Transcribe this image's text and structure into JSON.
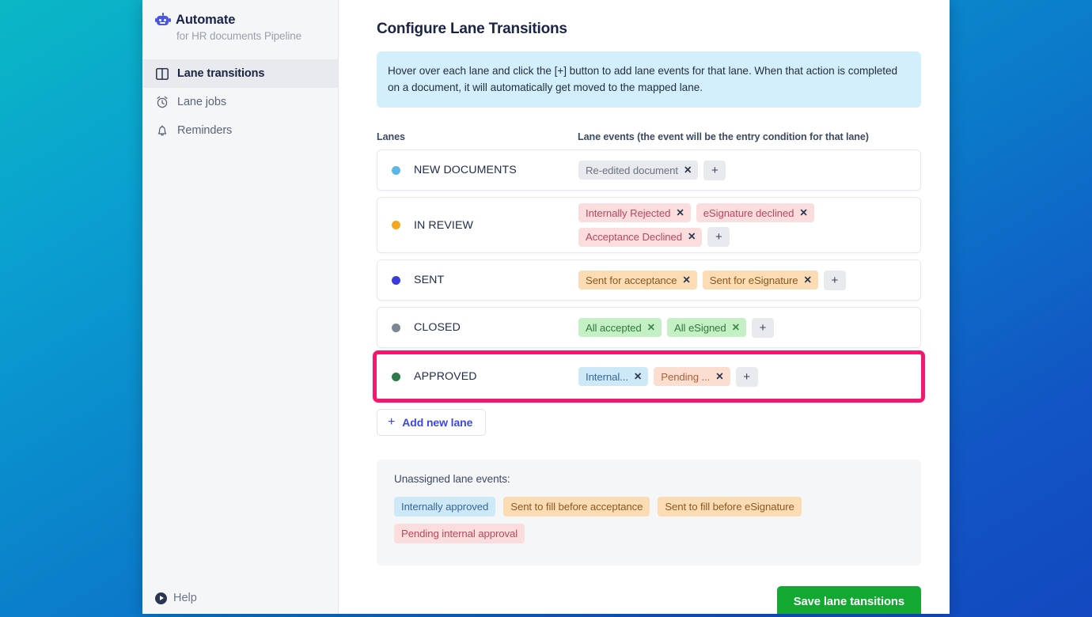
{
  "app": {
    "brand_name": "Automate",
    "brand_subtitle": "for HR documents Pipeline",
    "robot_icon": "robot-icon"
  },
  "sidebar": {
    "items": [
      {
        "label": "Lane transitions",
        "icon": "columns-icon",
        "active": true
      },
      {
        "label": "Lane jobs",
        "icon": "alarm-clock-icon",
        "active": false
      },
      {
        "label": "Reminders",
        "icon": "bell-icon",
        "active": false
      }
    ],
    "help_label": "Help",
    "help_icon": "play-circle-icon"
  },
  "main": {
    "title": "Configure Lane Transitions",
    "info_banner": "Hover over each lane and click the [+] button to add lane events for that lane. When that action is completed on a document, it will automatically get moved to the mapped lane.",
    "column_headers": {
      "lanes": "Lanes",
      "events": "Lane events (the event will be the entry condition for that lane)"
    },
    "add_button": {
      "plus": "+",
      "label": "Add new lane"
    },
    "plus_label": "+",
    "remove_label": "✕",
    "lanes": [
      {
        "name": "NEW DOCUMENTS",
        "dot_color": "#5bb7e8",
        "highlighted": false,
        "events": [
          {
            "label": "Re-edited document",
            "style": "gray"
          }
        ]
      },
      {
        "name": "IN REVIEW",
        "dot_color": "#f5a623",
        "highlighted": false,
        "events": [
          {
            "label": "Internally Rejected",
            "style": "rose"
          },
          {
            "label": "eSignature declined",
            "style": "rose"
          },
          {
            "label": "Acceptance Declined",
            "style": "rose"
          }
        ]
      },
      {
        "name": "SENT",
        "dot_color": "#3b3bdb",
        "highlighted": false,
        "events": [
          {
            "label": "Sent for acceptance",
            "style": "orange"
          },
          {
            "label": "Sent for eSignature",
            "style": "orange"
          }
        ]
      },
      {
        "name": "CLOSED",
        "dot_color": "#7d8694",
        "highlighted": false,
        "events": [
          {
            "label": "All accepted",
            "style": "green"
          },
          {
            "label": "All eSigned",
            "style": "green"
          }
        ]
      },
      {
        "name": "APPROVED",
        "dot_color": "#2f7a4a",
        "highlighted": true,
        "events": [
          {
            "label": "Internal...",
            "style": "blue"
          },
          {
            "label": "Pending ...",
            "style": "peach"
          }
        ]
      }
    ],
    "unassigned": {
      "title": "Unassigned lane events:",
      "tags": [
        {
          "label": "Internally approved",
          "style": "blue"
        },
        {
          "label": "Sent to fill before acceptance",
          "style": "orange"
        },
        {
          "label": "Sent to fill before eSignature",
          "style": "orange"
        },
        {
          "label": "Pending internal approval",
          "style": "rose"
        }
      ]
    },
    "save_label": "Save lane tansitions"
  },
  "colors": {
    "highlight_outline": "#f5176e",
    "save_green": "#12a832",
    "accent_blue": "#3b46e8",
    "banner_blue": "#d3effb",
    "background_gradient_start": "#0ab8c4",
    "background_gradient_end": "#1348c0"
  }
}
